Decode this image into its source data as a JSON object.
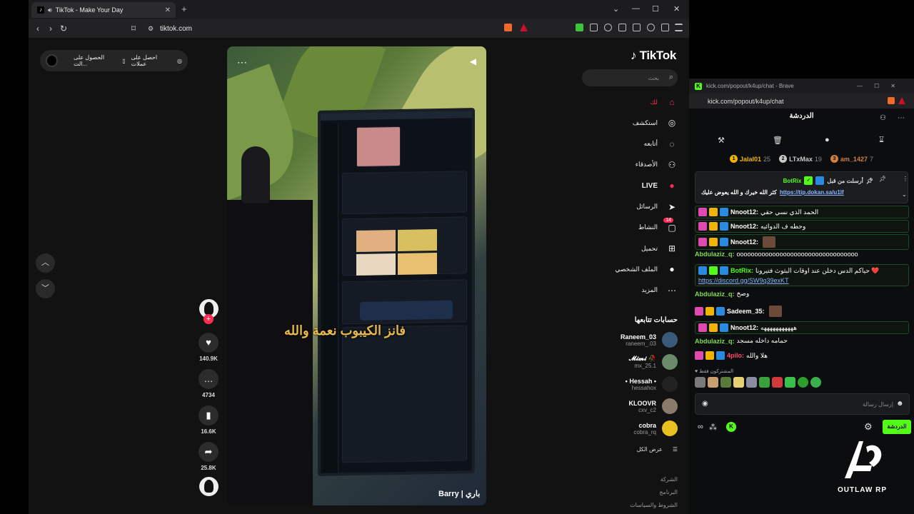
{
  "browser": {
    "tab_title": "TikTok - Make Your Day",
    "url": "tiktok.com",
    "new_tab": "+",
    "win_minimize": "—",
    "win_maximize": "☐",
    "win_close": "✕",
    "tab_close": "✕"
  },
  "tiktok": {
    "logo": "TikTok",
    "search_placeholder": "بحث",
    "promo_pill": {
      "get_coins": "احصل على عملات",
      "get_app": "الحصول على الت..."
    },
    "nav": [
      {
        "label": "لك",
        "icon": "home-icon",
        "glyph": "⌂",
        "active": true
      },
      {
        "label": "استكشف",
        "icon": "compass-icon",
        "glyph": "◎"
      },
      {
        "label": "أتابعه",
        "icon": "following-icon",
        "glyph": "◌"
      },
      {
        "label": "الأصدقاء",
        "icon": "friends-icon",
        "glyph": "⚇"
      },
      {
        "label": "LIVE",
        "icon": "live-icon",
        "glyph": "●"
      },
      {
        "label": "الرسائل",
        "icon": "messages-icon",
        "glyph": "➤"
      },
      {
        "label": "النشاط",
        "icon": "activity-icon",
        "glyph": "▢",
        "badge": "14"
      },
      {
        "label": "تحميل",
        "icon": "upload-icon",
        "glyph": "⊞"
      },
      {
        "label": "الملف الشخصي",
        "icon": "profile-icon",
        "glyph": "●"
      },
      {
        "label": "المزيد",
        "icon": "more-icon",
        "glyph": "⋯"
      }
    ],
    "following_title": "حسابات تتابعها",
    "following": [
      {
        "name": "Raneem_03",
        "handle": "raneem_.03",
        "color": "#3a5a7a"
      },
      {
        "name": "𝓜𝓲𝓶𝓲 🥀",
        "handle": "mx_25.1",
        "color": "#6a8a6a"
      },
      {
        "name": "• Hessah •",
        "handle": "hessahox",
        "color": "#222"
      },
      {
        "name": "KLOOVR",
        "handle": "cxv_c2",
        "color": "#8a7a6a"
      },
      {
        "name": "cobra",
        "handle": "cobra_rq",
        "color": "#e8c020"
      }
    ],
    "see_all": "عرض الكل",
    "footer": [
      "الشركة",
      "البرنامج",
      "الشروط والسياسات"
    ],
    "video": {
      "caption_overlay": "فانز الكيبوب نعمة والله",
      "author": "Barry | باري",
      "likes": "140.9K",
      "comments": "4734",
      "saves": "16.6K",
      "shares": "25.8K"
    }
  },
  "kick": {
    "window_title": "kick.com/popout/k4up/chat - Brave",
    "url": "kick.com/popout/k4up/chat",
    "header": "الدردشة",
    "top_users": [
      {
        "rank": "1",
        "name": "Jalal01",
        "score": "25",
        "color": "#f0b400"
      },
      {
        "rank": "2",
        "name": "LTxMax",
        "score": "19",
        "color": "#c8c8c8"
      },
      {
        "rank": "3",
        "name": "am_1427",
        "score": "7",
        "color": "#d08040"
      }
    ],
    "pinned": {
      "by": "أرسلت من قبل",
      "user": "BotRix",
      "text": "كثر الله خيرك و الله يعوض عليك",
      "link": "https://tip.dokan.sa/u1lf"
    },
    "messages": [
      {
        "user": "Nnoot12:",
        "text": "الحمد الذي نسي حقي",
        "color": "#ffffff"
      },
      {
        "user": "Nnoot12:",
        "text": "وحطه ف الدوائيه",
        "color": "#ffffff"
      },
      {
        "user": "Nnoot12:",
        "text": "",
        "color": "#ffffff"
      },
      {
        "user": "Abdulaziz_q:",
        "text": "oooooooooooooooooooooooooooooooooo",
        "color": "#7ddc4a"
      },
      {
        "user": "BotRix:",
        "text": "حياكم الدس دخلن عند اوقات البثوث فتيرونا ❤️",
        "color": "#53fc18",
        "link": "https://discord.gg/SW9q39exKT"
      },
      {
        "user": "Abdulaziz_q:",
        "text": "وصخ",
        "color": "#7ddc4a"
      },
      {
        "user": "Sadeem_35:",
        "text": "",
        "color": "#ffffff"
      },
      {
        "user": "Nnoot12:",
        "text": "هههههههههههه",
        "color": "#ffffff"
      },
      {
        "user": "Abdulaziz_q:",
        "text": "حمامه داخله مسجد",
        "color": "#7ddc4a"
      },
      {
        "user": "4pilo:",
        "text": "هلا والله",
        "color": "#ff4a6a"
      }
    ],
    "subs_only": "المشتركون فقط",
    "input_placeholder": "إرسال رسالة",
    "send_label": "الدردشة"
  },
  "overlay": {
    "brand": "OUTLAW RP"
  }
}
